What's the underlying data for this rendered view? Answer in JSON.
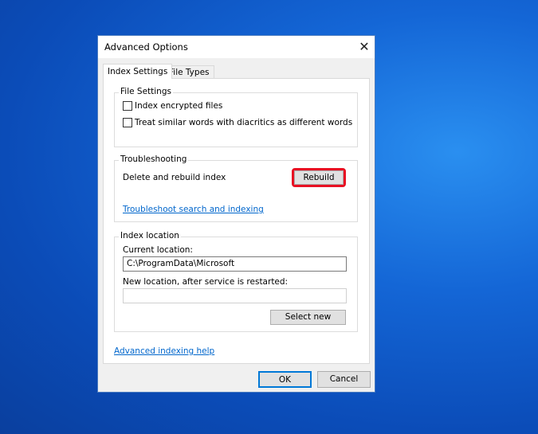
{
  "dialog": {
    "title": "Advanced Options",
    "close_icon": "close-icon"
  },
  "tabs": [
    {
      "label": "Index Settings",
      "active": true
    },
    {
      "label": "File Types",
      "active": false
    }
  ],
  "file_settings": {
    "legend": "File Settings",
    "options": [
      {
        "label": "Index encrypted files",
        "checked": false
      },
      {
        "label": "Treat similar words with diacritics as different words",
        "checked": false
      }
    ]
  },
  "troubleshooting": {
    "legend": "Troubleshooting",
    "rebuild_text": "Delete and rebuild index",
    "rebuild_button": "Rebuild",
    "highlight_color": "#e81123",
    "link": "Troubleshoot search and indexing"
  },
  "index_location": {
    "legend": "Index location",
    "current_label": "Current location:",
    "current_value": "C:\\ProgramData\\Microsoft",
    "new_label": "New location, after service is restarted:",
    "new_value": "",
    "select_button": "Select new"
  },
  "help_link": "Advanced indexing help",
  "footer": {
    "ok": "OK",
    "cancel": "Cancel"
  }
}
